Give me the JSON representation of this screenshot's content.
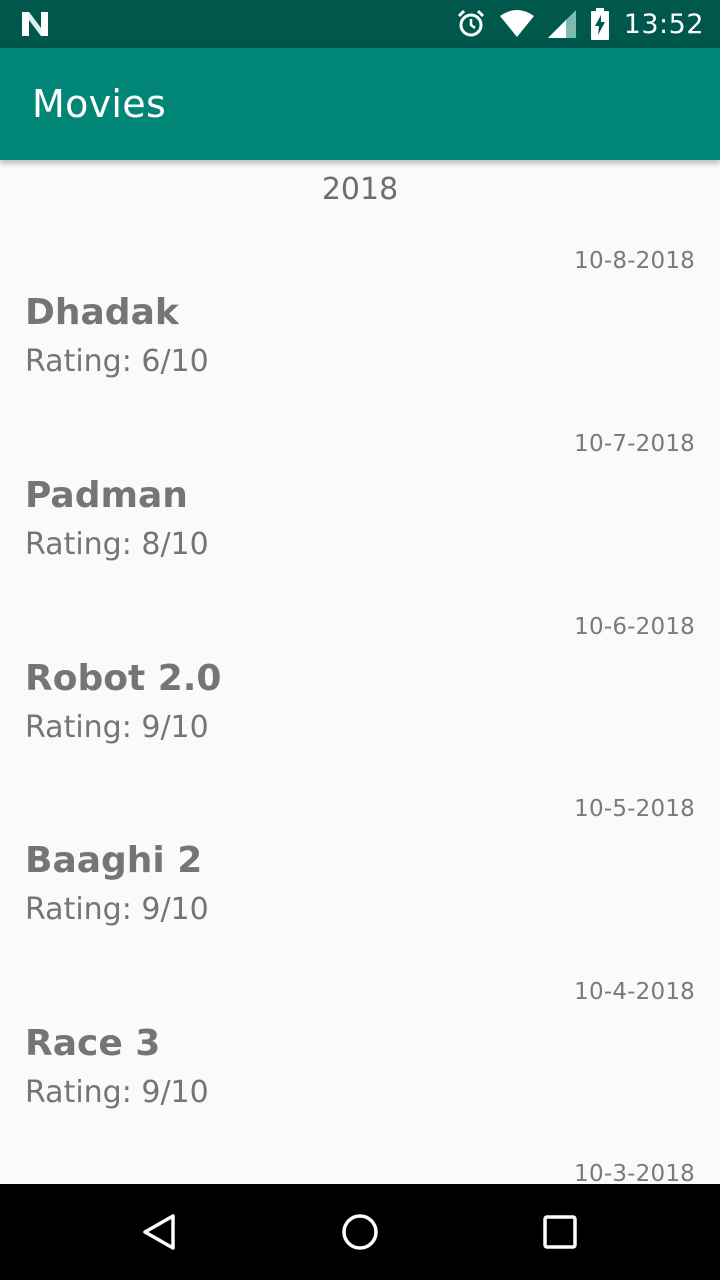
{
  "status_bar": {
    "time": "13:52",
    "icons": [
      "notification-n-icon",
      "alarm-icon",
      "wifi-icon",
      "signal-icon",
      "battery-charging-icon"
    ]
  },
  "app_bar": {
    "title": "Movies"
  },
  "list": {
    "section_header": "2018",
    "movies": [
      {
        "date": "10-8-2018",
        "title": "Dhadak",
        "rating": "Rating: 6/10"
      },
      {
        "date": "10-7-2018",
        "title": "Padman",
        "rating": "Rating: 8/10"
      },
      {
        "date": "10-6-2018",
        "title": "Robot 2.0",
        "rating": "Rating: 9/10"
      },
      {
        "date": "10-5-2018",
        "title": "Baaghi 2",
        "rating": "Rating: 9/10"
      },
      {
        "date": "10-4-2018",
        "title": "Race 3",
        "rating": "Rating: 9/10"
      },
      {
        "date": "10-3-2018",
        "title": "",
        "rating": ""
      }
    ]
  },
  "nav_bar": {
    "icons": [
      "back-icon",
      "home-icon",
      "recents-icon"
    ]
  },
  "colors": {
    "status_bar": "#00574b",
    "app_bar": "#008577",
    "background": "#fafafa",
    "text_gray": "#757575"
  }
}
